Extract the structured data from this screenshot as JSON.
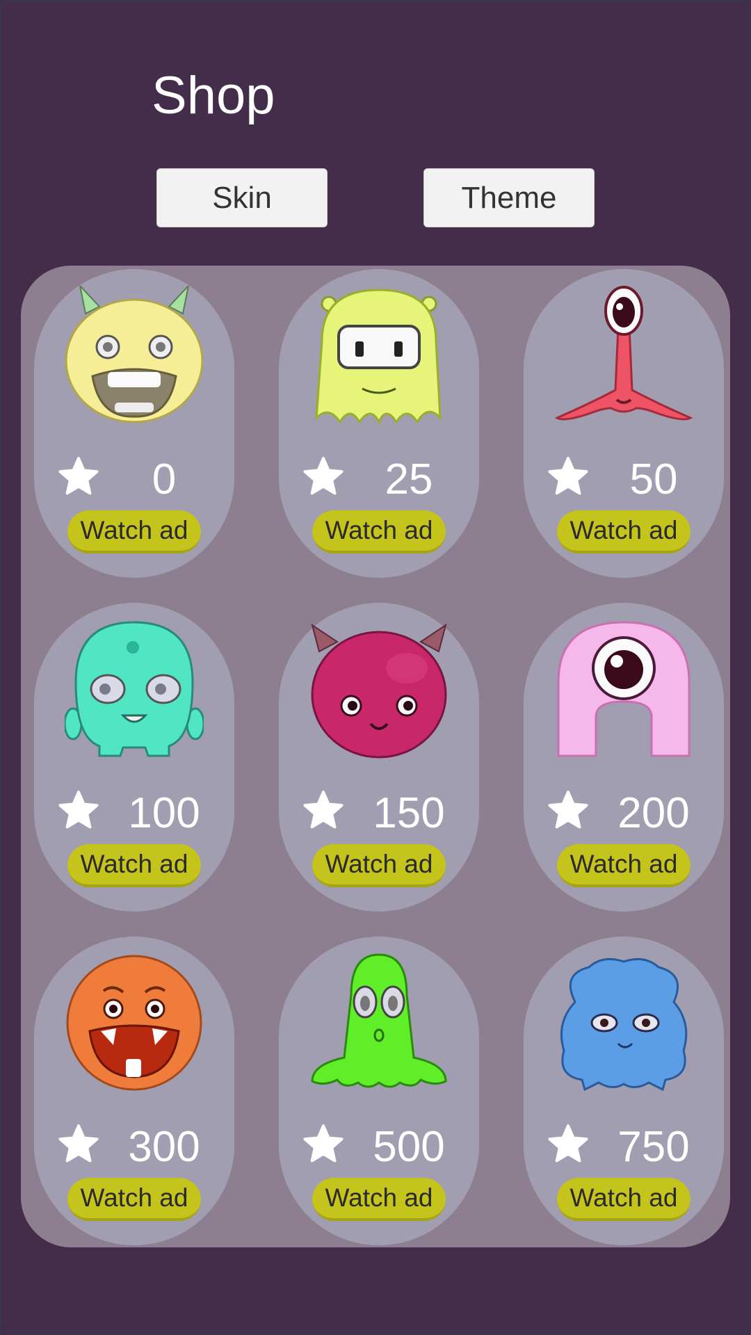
{
  "shop": {
    "title": "Shop",
    "tabs": [
      {
        "label": "Skin"
      },
      {
        "label": "Theme"
      }
    ],
    "items": [
      {
        "price": "0",
        "button": "Watch ad",
        "monster": "yellow-horned-monster-icon",
        "color": "#f4ec8c"
      },
      {
        "price": "25",
        "button": "Watch ad",
        "monster": "lime-ghost-monster-icon",
        "color": "#e6f47a"
      },
      {
        "price": "50",
        "button": "Watch ad",
        "monster": "red-eyestalk-monster-icon",
        "color": "#ee5466"
      },
      {
        "price": "100",
        "button": "Watch ad",
        "monster": "teal-blob-monster-icon",
        "color": "#50e6c4"
      },
      {
        "price": "150",
        "button": "Watch ad",
        "monster": "magenta-ball-monster-icon",
        "color": "#c8286a"
      },
      {
        "price": "200",
        "button": "Watch ad",
        "monster": "pink-cyclops-monster-icon",
        "color": "#f6b8ea"
      },
      {
        "price": "300",
        "button": "Watch ad",
        "monster": "orange-ball-monster-icon",
        "color": "#f07c3c"
      },
      {
        "price": "500",
        "button": "Watch ad",
        "monster": "green-slime-monster-icon",
        "color": "#60ee28"
      },
      {
        "price": "750",
        "button": "Watch ad",
        "monster": "blue-cloud-monster-icon",
        "color": "#5c9ee6"
      }
    ]
  },
  "colors": {
    "background": "#442d4a",
    "panel": "#8d7f90",
    "card": "#a09eb0",
    "ad_button": "#c4c41c",
    "tab_button": "#f2f2f2"
  }
}
